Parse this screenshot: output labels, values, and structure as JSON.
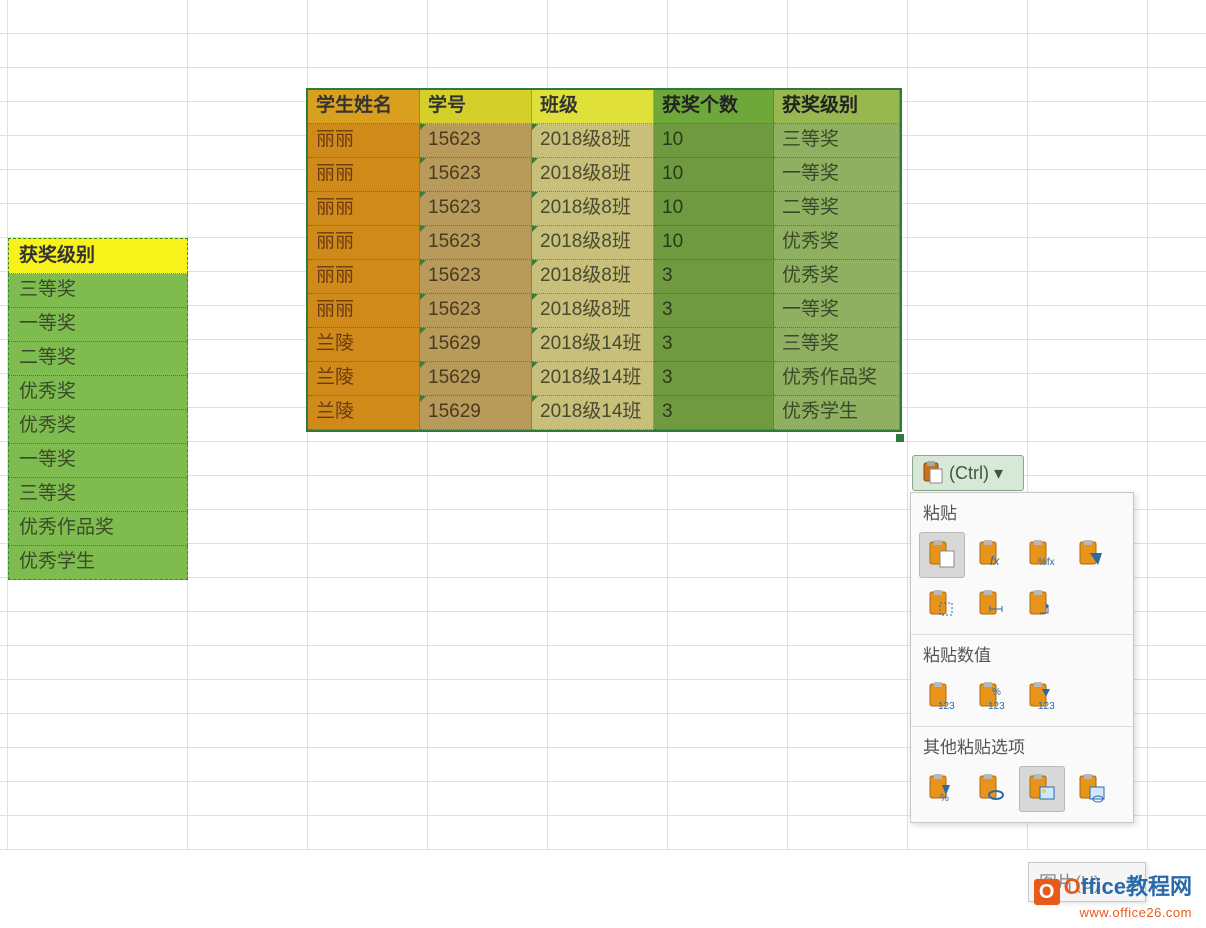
{
  "copy_column": {
    "header": "获奖级别",
    "cells": [
      "三等奖",
      "一等奖",
      "二等奖",
      "优秀奖",
      "优秀奖",
      "一等奖",
      "三等奖",
      "优秀作品奖",
      "优秀学生"
    ]
  },
  "main_table": {
    "headers": {
      "name": "学生姓名",
      "id": "学号",
      "cls": "班级",
      "cnt": "获奖个数",
      "lvl": "获奖级别"
    },
    "rows": [
      {
        "name": "丽丽",
        "id": "15623",
        "cls": "2018级8班",
        "cnt": "10",
        "lvl": "三等奖"
      },
      {
        "name": "丽丽",
        "id": "15623",
        "cls": "2018级8班",
        "cnt": "10",
        "lvl": "一等奖"
      },
      {
        "name": "丽丽",
        "id": "15623",
        "cls": "2018级8班",
        "cnt": "10",
        "lvl": "二等奖"
      },
      {
        "name": "丽丽",
        "id": "15623",
        "cls": "2018级8班",
        "cnt": "10",
        "lvl": "优秀奖"
      },
      {
        "name": "丽丽",
        "id": "15623",
        "cls": "2018级8班",
        "cnt": "3",
        "lvl": "优秀奖"
      },
      {
        "name": "丽丽",
        "id": "15623",
        "cls": "2018级8班",
        "cnt": "3",
        "lvl": "一等奖"
      },
      {
        "name": "兰陵",
        "id": "15629",
        "cls": "2018级14班",
        "cnt": "3",
        "lvl": "三等奖"
      },
      {
        "name": "兰陵",
        "id": "15629",
        "cls": "2018级14班",
        "cnt": "3",
        "lvl": "优秀作品奖"
      },
      {
        "name": "兰陵",
        "id": "15629",
        "cls": "2018级14班",
        "cnt": "3",
        "lvl": "优秀学生"
      }
    ]
  },
  "ctrl_button": {
    "label": "(Ctrl) ▾"
  },
  "flyout": {
    "sect1": "粘贴",
    "sect2": "粘贴数值",
    "sect3": "其他粘贴选项",
    "icons1": [
      "paste",
      "paste-fx",
      "paste-pctfx",
      "paste-formatting",
      "paste-noborder",
      "paste-colwidth",
      "paste-transpose"
    ],
    "icons2": [
      "paste-values-123",
      "paste-values-fmt-123",
      "paste-values-srcfmt-123"
    ],
    "icons3": [
      "paste-special",
      "paste-link",
      "paste-picture",
      "paste-linked-picture"
    ]
  },
  "pic_button": {
    "label": "图片(U)"
  },
  "watermark": {
    "line1a": "O",
    "line1b": "ffice教程网",
    "line2": "www.office26.com"
  }
}
